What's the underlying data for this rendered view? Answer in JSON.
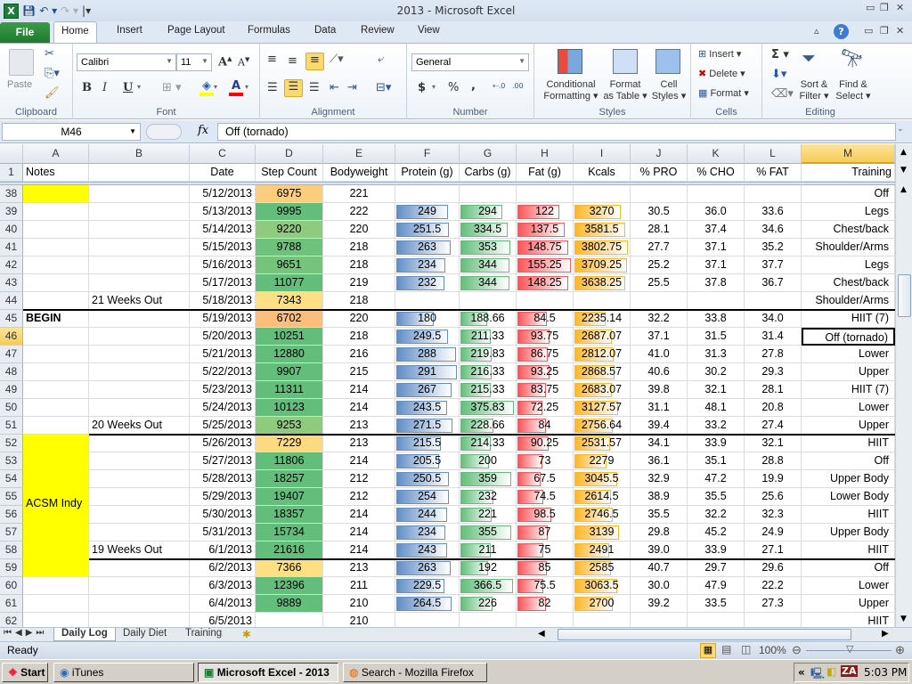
{
  "window": {
    "title": "2013  -  Microsoft Excel",
    "quick_access": {
      "save": "save-icon",
      "undo": "undo-icon",
      "redo": "redo-icon",
      "customize": "customize-icon"
    },
    "controls": {
      "minimize": "▭",
      "restore": "❐",
      "close": "✕"
    }
  },
  "ribbon_tabs": [
    {
      "label": "File"
    },
    {
      "label": "Home",
      "active": true
    },
    {
      "label": "Insert"
    },
    {
      "label": "Page Layout"
    },
    {
      "label": "Formulas"
    },
    {
      "label": "Data"
    },
    {
      "label": "Review"
    },
    {
      "label": "View"
    }
  ],
  "ribbon": {
    "clipboard": {
      "label": "Clipboard",
      "paste": "Paste"
    },
    "font": {
      "label": "Font",
      "font_name": "Calibri",
      "font_size": "11",
      "bold": "B",
      "italic": "I",
      "underline": "U",
      "highlight_color": "#ffff00",
      "font_color": "#ff0000"
    },
    "alignment": {
      "label": "Alignment"
    },
    "number": {
      "label": "Number",
      "format": "General",
      "currency": "$",
      "percent": "%",
      "comma": ",",
      "inc_decimal": "←.0 .00",
      "dec_decimal": ".00 →.0"
    },
    "styles": {
      "label": "Styles",
      "conditional": [
        "Conditional",
        "Formatting ▾"
      ],
      "format_table": [
        "Format",
        "as Table ▾"
      ],
      "cell_styles": [
        "Cell",
        "Styles ▾"
      ]
    },
    "cells": {
      "label": "Cells",
      "insert": "Insert ▾",
      "delete": "Delete ▾",
      "format": "Format ▾"
    },
    "editing": {
      "label": "Editing",
      "sum": "Σ ▾",
      "sort": [
        "Sort &",
        "Filter ▾"
      ],
      "find": [
        "Find &",
        "Select ▾"
      ]
    }
  },
  "formula_bar": {
    "name_box": "M46",
    "fx": "fx",
    "formula": "Off (tornado)"
  },
  "columns": [
    "A",
    "B",
    "C",
    "D",
    "E",
    "F",
    "G",
    "H",
    "I",
    "J",
    "K",
    "L",
    "M"
  ],
  "selected_column": "M",
  "header_row": {
    "row": "1",
    "cells": [
      "Notes",
      "",
      "Date",
      "Step Count",
      "Bodyweight",
      "Protein (g)",
      "Carbs (g)",
      "Fat (g)",
      "Kcals",
      "% PRO",
      "% CHO",
      "% FAT",
      "Training"
    ]
  },
  "rows": [
    {
      "row": "38",
      "a": "",
      "b": "",
      "date": "5/12/2013",
      "steps": "6975",
      "bw": "221",
      "pro": "",
      "carb": "",
      "fat": "",
      "kcal": "",
      "ppro": "",
      "pcho": "",
      "pfat": "",
      "training": "Off",
      "step_color": "#fdcd7e"
    },
    {
      "row": "39",
      "a": "",
      "b": "",
      "date": "5/13/2013",
      "steps": "9995",
      "bw": "222",
      "pro": "249",
      "carb": "294",
      "fat": "122",
      "kcal": "3270",
      "ppro": "30.5",
      "pcho": "36.0",
      "pfat": "33.6",
      "training": "Legs",
      "step_color": "#63be7b"
    },
    {
      "row": "40",
      "a": "",
      "b": "",
      "date": "5/14/2013",
      "steps": "9220",
      "bw": "220",
      "pro": "251.5",
      "carb": "334.5",
      "fat": "137.5",
      "kcal": "3581.5",
      "ppro": "28.1",
      "pcho": "37.4",
      "pfat": "34.6",
      "training": "Chest/back",
      "step_color": "#8fcb7f"
    },
    {
      "row": "41",
      "a": "",
      "b": "",
      "date": "5/15/2013",
      "steps": "9788",
      "bw": "218",
      "pro": "263",
      "carb": "353",
      "fat": "148.75",
      "kcal": "3802.75",
      "ppro": "27.7",
      "pcho": "37.1",
      "pfat": "35.2",
      "training": "Shoulder/Arms",
      "step_color": "#6ec27b"
    },
    {
      "row": "42",
      "a": "",
      "b": "",
      "date": "5/16/2013",
      "steps": "9651",
      "bw": "218",
      "pro": "234",
      "carb": "344",
      "fat": "155.25",
      "kcal": "3709.25",
      "ppro": "25.2",
      "pcho": "37.1",
      "pfat": "37.7",
      "training": "Legs",
      "step_color": "#76c47c"
    },
    {
      "row": "43",
      "a": "",
      "b": "",
      "date": "5/17/2013",
      "steps": "11077",
      "bw": "219",
      "pro": "232",
      "carb": "344",
      "fat": "148.25",
      "kcal": "3638.25",
      "ppro": "25.5",
      "pcho": "37.8",
      "pfat": "36.7",
      "training": "Chest/back",
      "step_color": "#63be7b"
    },
    {
      "row": "44",
      "a": "",
      "b": "21 Weeks Out",
      "date": "5/18/2013",
      "steps": "7343",
      "bw": "218",
      "pro": "",
      "carb": "",
      "fat": "",
      "kcal": "",
      "ppro": "",
      "pcho": "",
      "pfat": "",
      "training": "Shoulder/Arms",
      "step_color": "#fedf83"
    },
    {
      "row": "45",
      "a": "BEGIN",
      "b": "",
      "date": "5/19/2013",
      "steps": "6702",
      "bw": "220",
      "pro": "180",
      "carb": "188.66",
      "fat": "84.5",
      "kcal": "2235.14",
      "ppro": "32.2",
      "pcho": "33.8",
      "pfat": "34.0",
      "training": "HIIT (7)",
      "step_color": "#fcbf7b",
      "week_start": true
    },
    {
      "row": "46",
      "a": "",
      "b": "",
      "date": "5/20/2013",
      "steps": "10251",
      "bw": "218",
      "pro": "249.5",
      "carb": "211.33",
      "fat": "93.75",
      "kcal": "2687.07",
      "ppro": "37.1",
      "pcho": "31.5",
      "pfat": "31.4",
      "training": "Off (tornado)",
      "step_color": "#63be7b",
      "selected": true
    },
    {
      "row": "47",
      "a": "",
      "b": "",
      "date": "5/21/2013",
      "steps": "12880",
      "bw": "216",
      "pro": "288",
      "carb": "219.83",
      "fat": "86.75",
      "kcal": "2812.07",
      "ppro": "41.0",
      "pcho": "31.3",
      "pfat": "27.8",
      "training": "Lower",
      "step_color": "#63be7b"
    },
    {
      "row": "48",
      "a": "",
      "b": "",
      "date": "5/22/2013",
      "steps": "9907",
      "bw": "215",
      "pro": "291",
      "carb": "216.33",
      "fat": "93.25",
      "kcal": "2868.57",
      "ppro": "40.6",
      "pcho": "30.2",
      "pfat": "29.3",
      "training": "Upper",
      "step_color": "#63be7b"
    },
    {
      "row": "49",
      "a": "",
      "b": "",
      "date": "5/23/2013",
      "steps": "11311",
      "bw": "214",
      "pro": "267",
      "carb": "215.33",
      "fat": "83.75",
      "kcal": "2683.07",
      "ppro": "39.8",
      "pcho": "32.1",
      "pfat": "28.1",
      "training": "HIIT (7)",
      "step_color": "#63be7b"
    },
    {
      "row": "50",
      "a": "",
      "b": "",
      "date": "5/24/2013",
      "steps": "10123",
      "bw": "214",
      "pro": "243.5",
      "carb": "375.83",
      "fat": "72.25",
      "kcal": "3127.57",
      "ppro": "31.1",
      "pcho": "48.1",
      "pfat": "20.8",
      "training": "Lower",
      "step_color": "#63be7b"
    },
    {
      "row": "51",
      "a": "",
      "b": "20 Weeks Out",
      "date": "5/25/2013",
      "steps": "9253",
      "bw": "213",
      "pro": "271.5",
      "carb": "228.66",
      "fat": "84",
      "kcal": "2756.64",
      "ppro": "39.4",
      "pcho": "33.2",
      "pfat": "27.4",
      "training": "Upper",
      "step_color": "#8fcb7f"
    },
    {
      "row": "52",
      "a": "",
      "b": "",
      "date": "5/26/2013",
      "steps": "7229",
      "bw": "213",
      "pro": "215.5",
      "carb": "214.33",
      "fat": "90.25",
      "kcal": "2531.57",
      "ppro": "34.1",
      "pcho": "33.9",
      "pfat": "32.1",
      "training": "HIIT",
      "step_color": "#fdda80",
      "week_start": true
    },
    {
      "row": "53",
      "a": "",
      "b": "",
      "date": "5/27/2013",
      "steps": "11806",
      "bw": "214",
      "pro": "205.5",
      "carb": "200",
      "fat": "73",
      "kcal": "2279",
      "ppro": "36.1",
      "pcho": "35.1",
      "pfat": "28.8",
      "training": "Off",
      "step_color": "#63be7b"
    },
    {
      "row": "54",
      "a": "",
      "b": "",
      "date": "5/28/2013",
      "steps": "18257",
      "bw": "212",
      "pro": "250.5",
      "carb": "359",
      "fat": "67.5",
      "kcal": "3045.5",
      "ppro": "32.9",
      "pcho": "47.2",
      "pfat": "19.9",
      "training": "Upper Body",
      "step_color": "#63be7b"
    },
    {
      "row": "55",
      "a": "",
      "b": "",
      "date": "5/29/2013",
      "steps": "19407",
      "bw": "212",
      "pro": "254",
      "carb": "232",
      "fat": "74.5",
      "kcal": "2614.5",
      "ppro": "38.9",
      "pcho": "35.5",
      "pfat": "25.6",
      "training": "Lower Body",
      "step_color": "#63be7b"
    },
    {
      "row": "56",
      "a": "",
      "b": "",
      "date": "5/30/2013",
      "steps": "18357",
      "bw": "214",
      "pro": "244",
      "carb": "221",
      "fat": "98.5",
      "kcal": "2746.5",
      "ppro": "35.5",
      "pcho": "32.2",
      "pfat": "32.3",
      "training": "HIIT",
      "step_color": "#63be7b"
    },
    {
      "row": "57",
      "a": "",
      "b": "",
      "date": "5/31/2013",
      "steps": "15734",
      "bw": "214",
      "pro": "234",
      "carb": "355",
      "fat": "87",
      "kcal": "3139",
      "ppro": "29.8",
      "pcho": "45.2",
      "pfat": "24.9",
      "training": "Upper Body",
      "step_color": "#63be7b"
    },
    {
      "row": "58",
      "a": "",
      "b": "19 Weeks Out",
      "date": "6/1/2013",
      "steps": "21616",
      "bw": "214",
      "pro": "243",
      "carb": "211",
      "fat": "75",
      "kcal": "2491",
      "ppro": "39.0",
      "pcho": "33.9",
      "pfat": "27.1",
      "training": "HIIT",
      "step_color": "#63be7b"
    },
    {
      "row": "59",
      "a": "",
      "b": "",
      "date": "6/2/2013",
      "steps": "7366",
      "bw": "213",
      "pro": "263",
      "carb": "192",
      "fat": "85",
      "kcal": "2585",
      "ppro": "40.7",
      "pcho": "29.7",
      "pfat": "29.6",
      "training": "Off",
      "step_color": "#fee083",
      "week_start": true
    },
    {
      "row": "60",
      "a": "",
      "b": "",
      "date": "6/3/2013",
      "steps": "12396",
      "bw": "211",
      "pro": "229.5",
      "carb": "366.5",
      "fat": "75.5",
      "kcal": "3063.5",
      "ppro": "30.0",
      "pcho": "47.9",
      "pfat": "22.2",
      "training": "Lower",
      "step_color": "#63be7b"
    },
    {
      "row": "61",
      "a": "",
      "b": "",
      "date": "6/4/2013",
      "steps": "9889",
      "bw": "210",
      "pro": "264.5",
      "carb": "226",
      "fat": "82",
      "kcal": "2700",
      "ppro": "39.2",
      "pcho": "33.5",
      "pfat": "27.3",
      "training": "Upper",
      "step_color": "#63be7b"
    },
    {
      "row": "62",
      "a": "",
      "b": "",
      "date": "6/5/2013",
      "steps": "",
      "bw": "210",
      "pro": "",
      "carb": "",
      "fat": "",
      "kcal": "",
      "ppro": "",
      "pcho": "",
      "pfat": "",
      "training": "HIIT",
      "step_color": ""
    }
  ],
  "notes_block": {
    "label": "ACSM Indy",
    "color": "#ffff00"
  },
  "databar_colors": {
    "protein": "#638ec6",
    "carbs": "#63be7b",
    "fat": "#ff555a",
    "kcals": "#ffb628"
  },
  "databar_ranges": {
    "protein": [
      0,
      291
    ],
    "carbs": [
      0,
      375.83
    ],
    "fat": [
      0,
      155.25
    ],
    "kcals": [
      0,
      3802.75
    ]
  },
  "sheet_tabs": [
    {
      "label": "Daily Log",
      "active": true
    },
    {
      "label": "Daily Diet"
    },
    {
      "label": "Training"
    }
  ],
  "status": {
    "mode": "Ready",
    "zoom": "100%"
  },
  "taskbar": {
    "start": "Start",
    "items": [
      {
        "label": "iTunes"
      },
      {
        "label": "Microsoft Excel - 2013",
        "active": true
      },
      {
        "label": "Search - Mozilla Firefox"
      }
    ],
    "clock": "5:03 PM",
    "tray_expand": "«"
  }
}
